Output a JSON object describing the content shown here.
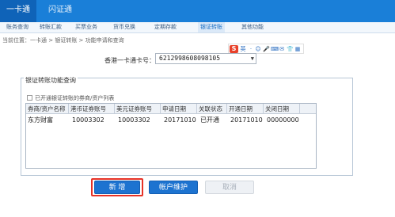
{
  "top_tabs": [
    {
      "label": "一卡通"
    },
    {
      "label": "闪证通"
    }
  ],
  "sub_nav": [
    {
      "label": "账务查询"
    },
    {
      "label": "转账汇款"
    },
    {
      "label": "买票业务"
    },
    {
      "label": "货币兑换"
    },
    {
      "label": "定期存款"
    },
    {
      "label": "银证转账"
    },
    {
      "label": "其他功能"
    }
  ],
  "breadcrumb": "当前位置：一卡通 > 银证转账 > 功能申请和查询",
  "card": {
    "label": "香港一卡通卡号：",
    "selected": "6212998608098105"
  },
  "ime": {
    "logo": "S",
    "icons": [
      "英",
      "·",
      "☺",
      "🎤",
      "⌨",
      "✉",
      "👕",
      "▦"
    ]
  },
  "panel": {
    "title": "银证转账功能查询",
    "checkbox_label": "已开通银证转账的券商/资户列表"
  },
  "table": {
    "headers": [
      "券商/资户名称",
      "港币证券账号",
      "美元证券账号",
      "申请日期",
      "关联状态",
      "开通日期",
      "关闭日期"
    ],
    "rows": [
      [
        "东方财富",
        "10003302",
        "10003302",
        "20171010",
        "已开通",
        "20171010",
        "00000000"
      ]
    ]
  },
  "buttons": {
    "add": "新 增",
    "account": "帐户维护",
    "cancel": "取消"
  },
  "colors": {
    "primary": "#1a7fd8",
    "highlight": "#e63226"
  }
}
